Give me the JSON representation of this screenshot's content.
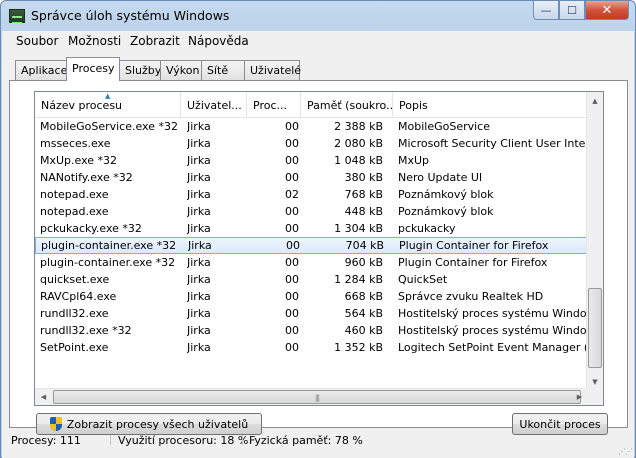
{
  "window": {
    "title": "Správce úloh systému Windows"
  },
  "caption": {
    "minimize": "—",
    "maximize": "☐",
    "close": "✕"
  },
  "menu": [
    "Soubor",
    "Možnosti",
    "Zobrazit",
    "Nápověda"
  ],
  "tabs": [
    "Aplikace",
    "Procesy",
    "Služby",
    "Výkon",
    "Sítě",
    "Uživatelé"
  ],
  "active_tab": "Procesy",
  "table": {
    "columns": [
      "Název procesu",
      "Uživatel...",
      "Proc...",
      "Paměť (soukro...",
      "Popis"
    ],
    "rows": [
      [
        "MobileGoService.exe *32",
        "Jirka",
        "00",
        "2 388 kB",
        "MobileGoService"
      ],
      [
        "msseces.exe",
        "Jirka",
        "00",
        "2 080 kB",
        "Microsoft Security Client User Interface"
      ],
      [
        "MxUp.exe *32",
        "Jirka",
        "00",
        "1 048 kB",
        "MxUp"
      ],
      [
        "NANotify.exe *32",
        "Jirka",
        "00",
        "380 kB",
        "Nero Update UI"
      ],
      [
        "notepad.exe",
        "Jirka",
        "02",
        "768 kB",
        "Poznámkový blok"
      ],
      [
        "notepad.exe",
        "Jirka",
        "00",
        "448 kB",
        "Poznámkový blok"
      ],
      [
        "pckukacky.exe *32",
        "Jirka",
        "00",
        "1 304 kB",
        "pckukacky"
      ],
      [
        "plugin-container.exe *32",
        "Jirka",
        "00",
        "704 kB",
        "Plugin Container for Firefox"
      ],
      [
        "plugin-container.exe *32",
        "Jirka",
        "00",
        "960 kB",
        "Plugin Container for Firefox"
      ],
      [
        "quickset.exe",
        "Jirka",
        "00",
        "1 284 kB",
        "QuickSet"
      ],
      [
        "RAVCpl64.exe",
        "Jirka",
        "00",
        "668 kB",
        "Správce zvuku Realtek HD"
      ],
      [
        "rundll32.exe",
        "Jirka",
        "00",
        "564 kB",
        "Hostitelský proces systému Windows (..."
      ],
      [
        "rundll32.exe *32",
        "Jirka",
        "00",
        "460 kB",
        "Hostitelský proces systému Windows (..."
      ],
      [
        "SetPoint.exe",
        "Jirka",
        "00",
        "1 352 kB",
        "Logitech SetPoint Event Manager (UNI..."
      ]
    ],
    "selected_row": 7
  },
  "buttons": {
    "show_all": "Zobrazit procesy všech uživatelů",
    "end_process": "Ukončit proces"
  },
  "status": {
    "processes": "Procesy: 111",
    "cpu": "Využití procesoru: 18 %",
    "memory": "Fyzická paměť: 78 %"
  }
}
